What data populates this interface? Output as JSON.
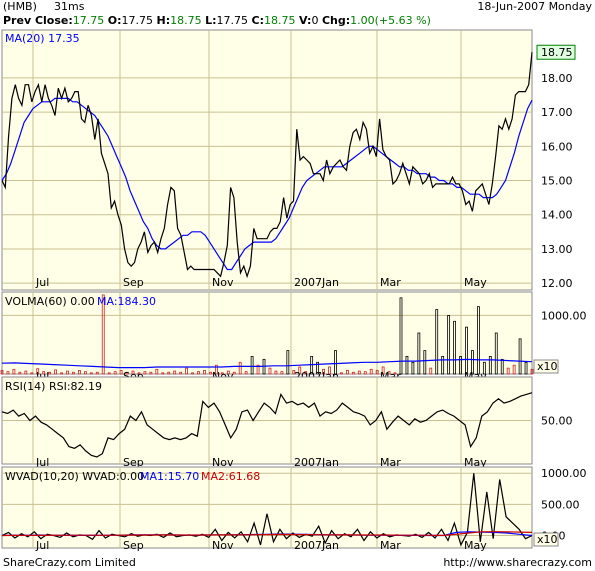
{
  "header": {
    "symbol": "(HMB)",
    "timing": "31ms",
    "date": "18-Jun-2007 Monday",
    "prev_close_label": "Prev Close:",
    "prev_close": "17.75",
    "open_label": "O:",
    "open": "17.75",
    "high_label": "H:",
    "high": "18.75",
    "low_label": "L:",
    "low": "17.75",
    "close_label": "C:",
    "close": "18.75",
    "volume_label": "V:",
    "volume": "0",
    "change_label": "Chg:",
    "change": "1.00(+5.63 %)"
  },
  "footer": {
    "left": "ShareCrazy.com Limited",
    "right": "http://www.sharecrazy.com"
  },
  "colors": {
    "panel_bg": "#ffffe8",
    "grid": "#c8c090",
    "price_line": "#000000",
    "ma_line": "#0000ff",
    "volume_bar": "#cc2222",
    "ma2_line": "#cc0000"
  },
  "chart_data": [
    {
      "type": "line",
      "panel": "price",
      "title": "MA(20) 17.35",
      "last_value_label": "18.75",
      "x_tick_labels": [
        "Jul",
        "Sep",
        "Nov",
        "2007Jan",
        "Mar",
        "May"
      ],
      "y_tick_labels": [
        "18.00",
        "17.00",
        "16.00",
        "15.00",
        "14.00",
        "13.00",
        "12.00"
      ],
      "ylim": [
        11.8,
        19.4
      ],
      "series": [
        {
          "name": "",
          "values": [
            15.0,
            14.8,
            16.3,
            17.4,
            17.8,
            17.4,
            17.2,
            17.8,
            17.8,
            17.3,
            17.6,
            17.8,
            17.3,
            17.8,
            17.4,
            17.2,
            16.9,
            17.7,
            17.4,
            17.7,
            17.3,
            17.4,
            17.6,
            17.6,
            16.8,
            16.7,
            17.2,
            16.9,
            16.2,
            16.8,
            15.8,
            15.5,
            15.2,
            14.2,
            14.4,
            14.0,
            13.7,
            13.0,
            12.6,
            12.5,
            12.6,
            13.0,
            13.2,
            13.5,
            12.9,
            13.1,
            13.2,
            12.9,
            13.3,
            13.6,
            14.3,
            14.8,
            14.7,
            13.6,
            13.4,
            12.9,
            12.4,
            12.5,
            12.4,
            12.4,
            12.4,
            12.4,
            12.4,
            12.4,
            12.4,
            12.3,
            12.2,
            12.6,
            13.1,
            14.8,
            14.5,
            13.2,
            12.3,
            12.5,
            12.2,
            12.5,
            13.6,
            13.3,
            13.3,
            13.3,
            13.3,
            13.5,
            13.6,
            13.6,
            13.8,
            14.5,
            13.9,
            14.3,
            14.4,
            16.5,
            15.6,
            15.7,
            15.6,
            15.5,
            15.2,
            15.2,
            15.2,
            15.0,
            15.6,
            15.2,
            15.4,
            15.5,
            15.6,
            15.4,
            15.3,
            16.0,
            16.4,
            16.5,
            16.2,
            16.7,
            16.5,
            15.8,
            16.0,
            15.7,
            16.8,
            15.9,
            15.7,
            15.6,
            14.9,
            15.0,
            15.2,
            15.5,
            15.2,
            14.9,
            15.4,
            15.3,
            15.2,
            14.9,
            15.0,
            15.2,
            14.8,
            14.9,
            14.9,
            14.9,
            14.9,
            14.9,
            15.1,
            14.9,
            14.9,
            14.7,
            14.3,
            14.4,
            14.1,
            14.7,
            14.8,
            14.9,
            14.6,
            14.3,
            14.9,
            15.7,
            16.6,
            16.5,
            16.8,
            16.5,
            16.8,
            17.5,
            17.6,
            17.6,
            17.6,
            17.8,
            18.75
          ]
        },
        {
          "name": "MA(20)",
          "values": [
            15.0,
            15.2,
            15.5,
            15.9,
            16.3,
            16.7,
            16.9,
            17.1,
            17.2,
            17.3,
            17.3,
            17.3,
            17.4,
            17.4,
            17.4,
            17.4,
            17.3,
            17.3,
            17.2,
            17.1,
            17.0,
            16.9,
            16.7,
            16.5,
            16.3,
            16.0,
            15.7,
            15.4,
            15.1,
            14.7,
            14.4,
            14.1,
            13.8,
            13.6,
            13.3,
            13.1,
            13.0,
            13.0,
            13.1,
            13.2,
            13.3,
            13.4,
            13.4,
            13.5,
            13.5,
            13.5,
            13.4,
            13.2,
            13.0,
            12.8,
            12.6,
            12.4,
            12.4,
            12.6,
            12.8,
            13.0,
            13.1,
            13.2,
            13.2,
            13.2,
            13.2,
            13.2,
            13.3,
            13.5,
            13.7,
            13.9,
            14.2,
            14.5,
            14.8,
            15.0,
            15.1,
            15.2,
            15.3,
            15.4,
            15.4,
            15.4,
            15.4,
            15.4,
            15.5,
            15.6,
            15.7,
            15.8,
            15.9,
            16.0,
            16.0,
            15.9,
            15.8,
            15.7,
            15.6,
            15.5,
            15.4,
            15.4,
            15.3,
            15.3,
            15.2,
            15.2,
            15.2,
            15.1,
            15.1,
            15.0,
            15.0,
            14.9,
            14.9,
            14.8,
            14.8,
            14.7,
            14.6,
            14.6,
            14.6,
            14.5,
            14.5,
            14.5,
            14.6,
            14.8,
            15.0,
            15.4,
            15.8,
            16.3,
            16.7,
            17.1,
            17.35
          ]
        }
      ]
    },
    {
      "type": "bar",
      "panel": "volume",
      "title": "VOLMA(60) 0.00",
      "ma_label": "MA:184.30",
      "y_tick_labels": [
        "1000.00",
        "0"
      ],
      "multiplier_label": "x10",
      "ylim": [
        0,
        1400
      ],
      "series": [
        {
          "name": "",
          "values": [
            60,
            40,
            80,
            30,
            50,
            20,
            90,
            40,
            30,
            70,
            20,
            50,
            30,
            60,
            40,
            20,
            30,
            1350,
            20,
            40,
            60,
            30,
            50,
            20,
            40,
            30,
            80,
            20,
            30,
            50,
            30,
            100,
            20,
            40,
            60,
            30,
            150,
            20,
            50,
            30,
            200,
            40,
            300,
            150,
            250,
            100,
            50,
            40,
            400,
            60,
            120,
            40,
            300,
            200,
            80,
            120,
            400,
            20,
            60,
            30,
            50,
            40,
            80,
            60,
            120,
            40,
            20,
            1300,
            300,
            200,
            700,
            400,
            100,
            1100,
            300,
            1000,
            900,
            300,
            800,
            400,
            1150,
            200,
            300,
            700,
            250,
            100,
            150,
            600,
            200,
            80
          ]
        },
        {
          "name": "MA",
          "values": [
            184,
            190,
            180,
            170,
            160,
            150,
            140,
            130,
            120,
            110,
            110,
            110,
            120,
            120,
            120,
            120,
            120,
            120,
            130,
            130,
            130,
            140,
            140,
            150,
            160,
            170,
            180,
            190,
            200,
            200,
            210,
            220,
            220,
            230,
            240,
            240,
            250,
            240,
            240,
            230,
            220,
            210
          ]
        }
      ]
    },
    {
      "type": "line",
      "panel": "rsi",
      "title": "RSI(14) RSI:82.19",
      "y_tick_labels": [
        "50.00"
      ],
      "ylim": [
        0,
        100
      ],
      "series": [
        {
          "name": "",
          "values": [
            60,
            58,
            62,
            55,
            58,
            50,
            55,
            48,
            45,
            40,
            35,
            30,
            20,
            18,
            22,
            15,
            10,
            8,
            12,
            30,
            28,
            35,
            40,
            55,
            50,
            60,
            45,
            40,
            35,
            30,
            28,
            30,
            28,
            30,
            35,
            32,
            72,
            65,
            70,
            60,
            45,
            30,
            40,
            60,
            62,
            50,
            60,
            70,
            65,
            58,
            80,
            70,
            72,
            68,
            70,
            65,
            70,
            55,
            60,
            58,
            62,
            70,
            65,
            60,
            58,
            55,
            45,
            50,
            60,
            40,
            48,
            55,
            50,
            45,
            52,
            48,
            50,
            55,
            60,
            62,
            58,
            55,
            50,
            45,
            20,
            30,
            55,
            60,
            70,
            75,
            70,
            72,
            75,
            78,
            80,
            82
          ]
        }
      ]
    },
    {
      "type": "line",
      "panel": "wvad",
      "title": "WVAD(10,20) WVAD:0.00",
      "ma1_label": "MA1:15.70",
      "ma2_label": "MA2:61.68",
      "y_tick_labels": [
        "1000.00",
        "500.00",
        "0.00"
      ],
      "multiplier_label": "x10",
      "ylim": [
        -200,
        1100
      ],
      "series": [
        {
          "name": "",
          "values": [
            0,
            50,
            -40,
            30,
            -20,
            60,
            -50,
            20,
            0,
            -30,
            40,
            -20,
            10,
            0,
            -60,
            80,
            -40,
            20,
            0,
            -20,
            30,
            -10,
            10,
            0,
            20,
            -30,
            40,
            -20,
            0,
            10,
            -10,
            20,
            -30,
            100,
            -80,
            50,
            -40,
            60,
            -100,
            200,
            -150,
            350,
            -100,
            100,
            -50,
            40,
            -30,
            20,
            -10,
            150,
            -120,
            80,
            -50,
            30,
            -20,
            100,
            -80,
            60,
            -40,
            30,
            -20,
            10,
            0,
            -10,
            20,
            -30,
            50,
            -40,
            100,
            -80,
            200,
            -150,
            50,
            1000,
            -100,
            700,
            -50,
            900,
            300,
            200,
            100,
            -50,
            0
          ]
        },
        {
          "name": "MA1",
          "values": [
            0,
            5,
            2,
            8,
            4,
            6,
            3,
            5,
            4,
            6,
            8,
            10,
            12,
            10,
            8,
            6,
            8,
            10,
            12,
            14,
            16,
            20,
            25,
            22,
            18,
            15,
            12,
            10,
            8,
            6,
            5,
            4,
            3,
            2,
            1,
            0,
            50,
            60,
            55,
            50,
            40,
            20,
            0
          ]
        },
        {
          "name": "MA2",
          "values": [
            0,
            2,
            4,
            3,
            5,
            4,
            6,
            5,
            4,
            6,
            7,
            8,
            9,
            10,
            9,
            8,
            9,
            10,
            11,
            12,
            13,
            15,
            18,
            17,
            15,
            14,
            12,
            11,
            10,
            9,
            8,
            7,
            6,
            5,
            4,
            3,
            20,
            40,
            60,
            62,
            60,
            55,
            50
          ]
        }
      ]
    }
  ]
}
